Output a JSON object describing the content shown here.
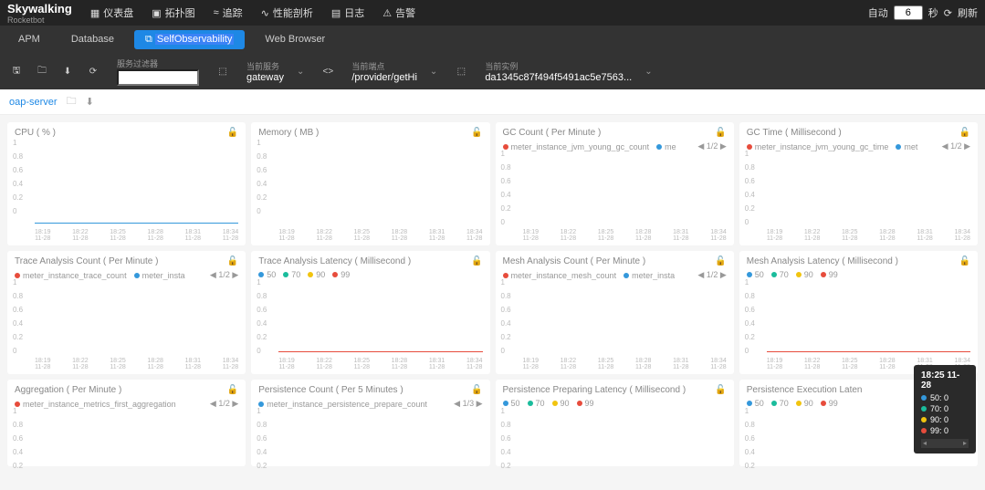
{
  "header": {
    "brand": "Skywalking",
    "brand_sub": "Rocketbot",
    "nav": [
      "仪表盘",
      "拓扑图",
      "追踪",
      "性能剖析",
      "日志",
      "告警"
    ],
    "auto_label": "自动",
    "seconds_value": "6",
    "seconds_label": "秒",
    "refresh_label": "刷新"
  },
  "tabs": [
    "APM",
    "Database",
    "SelfObservability",
    "Web Browser"
  ],
  "active_tab": "SelfObservability",
  "filters": {
    "service_filter_label": "服务过滤器",
    "current_service_label": "当前服务",
    "current_service": "gateway",
    "current_endpoint_label": "当前端点",
    "current_endpoint": "/provider/getHi",
    "current_instance_label": "当前实例",
    "current_instance": "da1345c87f494f5491ac5e7563..."
  },
  "subbar": {
    "item": "oap-server"
  },
  "chart_data": [
    {
      "title": "CPU ( % )",
      "legend": [],
      "yticks": [
        "1",
        "0.8",
        "0.6",
        "0.4",
        "0.2",
        "0"
      ],
      "xticks": [
        [
          "18:19",
          "11-28"
        ],
        [
          "18:22",
          "11-28"
        ],
        [
          "18:25",
          "11-28"
        ],
        [
          "18:28",
          "11-28"
        ],
        [
          "18:31",
          "11-28"
        ],
        [
          "18:34",
          "11-28"
        ]
      ],
      "baseline": "blue"
    },
    {
      "title": "Memory ( MB )",
      "legend": [],
      "yticks": [
        "1",
        "0.8",
        "0.6",
        "0.4",
        "0.2",
        "0"
      ],
      "xticks": [
        [
          "18:19",
          "11-28"
        ],
        [
          "18:22",
          "11-28"
        ],
        [
          "18:25",
          "11-28"
        ],
        [
          "18:28",
          "11-28"
        ],
        [
          "18:31",
          "11-28"
        ],
        [
          "18:34",
          "11-28"
        ]
      ]
    },
    {
      "title": "GC Count ( Per Minute )",
      "legend": [
        {
          "c": "#e74c3c",
          "t": "meter_instance_jvm_young_gc_count"
        },
        {
          "c": "#3498db",
          "t": "me"
        }
      ],
      "pager": "1/2",
      "yticks": [
        "1",
        "0.8",
        "0.6",
        "0.4",
        "0.2",
        "0"
      ],
      "xticks": [
        [
          "18:19",
          "11-28"
        ],
        [
          "18:22",
          "11-28"
        ],
        [
          "18:25",
          "11-28"
        ],
        [
          "18:28",
          "11-28"
        ],
        [
          "18:31",
          "11-28"
        ],
        [
          "18:34",
          "11-28"
        ]
      ]
    },
    {
      "title": "GC Time ( Millisecond )",
      "legend": [
        {
          "c": "#e74c3c",
          "t": "meter_instance_jvm_young_gc_time"
        },
        {
          "c": "#3498db",
          "t": "met"
        }
      ],
      "pager": "1/2",
      "yticks": [
        "1",
        "0.8",
        "0.6",
        "0.4",
        "0.2",
        "0"
      ],
      "xticks": [
        [
          "18:19",
          "11-28"
        ],
        [
          "18:22",
          "11-28"
        ],
        [
          "18:25",
          "11-28"
        ],
        [
          "18:28",
          "11-28"
        ],
        [
          "18:31",
          "11-28"
        ],
        [
          "18:34",
          "11-28"
        ]
      ]
    },
    {
      "title": "Trace Analysis Count ( Per Minute )",
      "legend": [
        {
          "c": "#e74c3c",
          "t": "meter_instance_trace_count"
        },
        {
          "c": "#3498db",
          "t": "meter_insta"
        }
      ],
      "pager": "1/2",
      "yticks": [
        "1",
        "0.8",
        "0.6",
        "0.4",
        "0.2",
        "0"
      ],
      "xticks": [
        [
          "18:19",
          "11-28"
        ],
        [
          "18:22",
          "11-28"
        ],
        [
          "18:25",
          "11-28"
        ],
        [
          "18:28",
          "11-28"
        ],
        [
          "18:31",
          "11-28"
        ],
        [
          "18:34",
          "11-28"
        ]
      ]
    },
    {
      "title": "Trace Analysis Latency ( Millisecond )",
      "legend": [
        {
          "c": "#3498db",
          "t": "50"
        },
        {
          "c": "#1abc9c",
          "t": "70"
        },
        {
          "c": "#f1c40f",
          "t": "90"
        },
        {
          "c": "#e74c3c",
          "t": "99"
        }
      ],
      "yticks": [
        "1",
        "0.8",
        "0.6",
        "0.4",
        "0.2",
        "0"
      ],
      "xticks": [
        [
          "18:19",
          "11-28"
        ],
        [
          "18:22",
          "11-28"
        ],
        [
          "18:25",
          "11-28"
        ],
        [
          "18:28",
          "11-28"
        ],
        [
          "18:31",
          "11-28"
        ],
        [
          "18:34",
          "11-28"
        ]
      ],
      "baseline": "red"
    },
    {
      "title": "Mesh Analysis Count ( Per Minute )",
      "legend": [
        {
          "c": "#e74c3c",
          "t": "meter_instance_mesh_count"
        },
        {
          "c": "#3498db",
          "t": "meter_insta"
        }
      ],
      "pager": "1/2",
      "yticks": [
        "1",
        "0.8",
        "0.6",
        "0.4",
        "0.2",
        "0"
      ],
      "xticks": [
        [
          "18:19",
          "11-28"
        ],
        [
          "18:22",
          "11-28"
        ],
        [
          "18:25",
          "11-28"
        ],
        [
          "18:28",
          "11-28"
        ],
        [
          "18:31",
          "11-28"
        ],
        [
          "18:34",
          "11-28"
        ]
      ]
    },
    {
      "title": "Mesh Analysis Latency ( Millisecond )",
      "legend": [
        {
          "c": "#3498db",
          "t": "50"
        },
        {
          "c": "#1abc9c",
          "t": "70"
        },
        {
          "c": "#f1c40f",
          "t": "90"
        },
        {
          "c": "#e74c3c",
          "t": "99"
        }
      ],
      "yticks": [
        "1",
        "0.8",
        "0.6",
        "0.4",
        "0.2",
        "0"
      ],
      "xticks": [
        [
          "18:19",
          "11-28"
        ],
        [
          "18:22",
          "11-28"
        ],
        [
          "18:25",
          "11-28"
        ],
        [
          "18:28",
          "11-28"
        ],
        [
          "18:31",
          "11-28"
        ],
        [
          "18:34",
          "11-28"
        ]
      ],
      "baseline": "red"
    },
    {
      "title": "Aggregation ( Per Minute )",
      "legend": [
        {
          "c": "#e74c3c",
          "t": "meter_instance_metrics_first_aggregation"
        }
      ],
      "pager": "1/2",
      "yticks": [
        "1",
        "0.8",
        "0.6",
        "0.4",
        "0.2"
      ],
      "short": true
    },
    {
      "title": "Persistence Count ( Per 5 Minutes )",
      "legend": [
        {
          "c": "#3498db",
          "t": "meter_instance_persistence_prepare_count"
        }
      ],
      "pager": "1/3",
      "yticks": [
        "1",
        "0.8",
        "0.6",
        "0.4",
        "0.2"
      ],
      "short": true
    },
    {
      "title": "Persistence Preparing Latency ( Millisecond )",
      "legend": [
        {
          "c": "#3498db",
          "t": "50"
        },
        {
          "c": "#1abc9c",
          "t": "70"
        },
        {
          "c": "#f1c40f",
          "t": "90"
        },
        {
          "c": "#e74c3c",
          "t": "99"
        }
      ],
      "yticks": [
        "1",
        "0.8",
        "0.6",
        "0.4",
        "0.2"
      ],
      "short": true
    },
    {
      "title": "Persistence Execution Laten",
      "legend": [
        {
          "c": "#3498db",
          "t": "50"
        },
        {
          "c": "#1abc9c",
          "t": "70"
        },
        {
          "c": "#f1c40f",
          "t": "90"
        },
        {
          "c": "#e74c3c",
          "t": "99"
        }
      ],
      "yticks": [
        "1",
        "0.8",
        "0.6",
        "0.4",
        "0.2"
      ],
      "short": true
    }
  ],
  "tooltip": {
    "title": "18:25 11-28",
    "rows": [
      {
        "c": "#3498db",
        "t": "50: 0"
      },
      {
        "c": "#1abc9c",
        "t": "70: 0"
      },
      {
        "c": "#f1c40f",
        "t": "90: 0"
      },
      {
        "c": "#e74c3c",
        "t": "99: 0"
      }
    ]
  }
}
